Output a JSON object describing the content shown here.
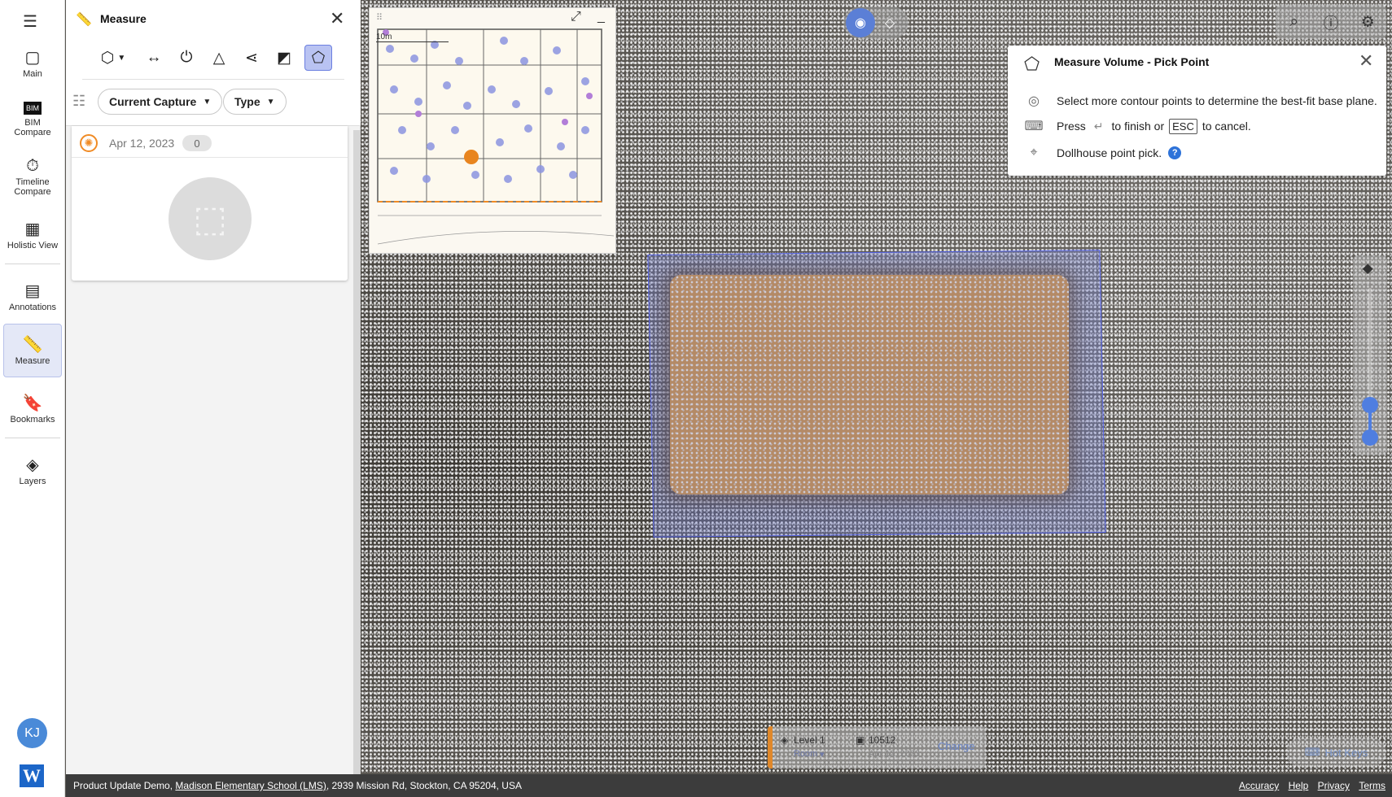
{
  "nav": {
    "items": [
      {
        "label": "Main",
        "icon": "main-view-icon"
      },
      {
        "label": "BIM Compare",
        "icon": "bim-icon",
        "badge": "BIM"
      },
      {
        "label": "Timeline Compare",
        "icon": "timeline-icon"
      },
      {
        "label": "Holistic View",
        "icon": "grid-icon"
      },
      {
        "label": "Annotations",
        "icon": "annotations-icon"
      },
      {
        "label": "Measure",
        "icon": "ruler-icon"
      },
      {
        "label": "Bookmarks",
        "icon": "bookmark-icon"
      },
      {
        "label": "Layers",
        "icon": "layers-icon"
      }
    ],
    "active": "Measure",
    "avatar_initials": "KJ",
    "brand_letter": "W"
  },
  "measure_panel": {
    "title": "Measure",
    "tools": [
      "volume-tool",
      "distance-tool",
      "angle-tool",
      "area-tool",
      "polyline-tool",
      "plane-tool",
      "volume-pick-tool"
    ],
    "filters": {
      "capture": "Current Capture",
      "type": "Type"
    },
    "capture": {
      "date": "Apr 12, 2023",
      "count": "0"
    }
  },
  "minimap": {
    "scale_label": "10m"
  },
  "instruction": {
    "title": "Measure Volume - Pick Point",
    "line1": "Select more contour points to determine the best-fit base plane.",
    "press": "Press",
    "finish": "to finish or",
    "esc": "ESC",
    "cancel": "to cancel.",
    "line3": "Dollhouse point pick.",
    "help": "?"
  },
  "level_bar": {
    "level": "Level 1",
    "room": "Room",
    "capture_id": "10512",
    "capture_date": "Apr 12, 2023",
    "change": "Change"
  },
  "hotkeys": "Hot Keys",
  "footer": {
    "prefix": "Product Update Demo,",
    "project_link": "Madison Elementary School (LMS)",
    "address": ", 2939 Mission Rd, Stockton, CA 95204, USA",
    "links": [
      "Accuracy",
      "Help",
      "Privacy",
      "Terms"
    ]
  },
  "colors": {
    "accent": "#5b7fd6",
    "selection": "#5563e6",
    "capture_orange": "#f08b25",
    "footer_bg": "#3c3c3c"
  }
}
